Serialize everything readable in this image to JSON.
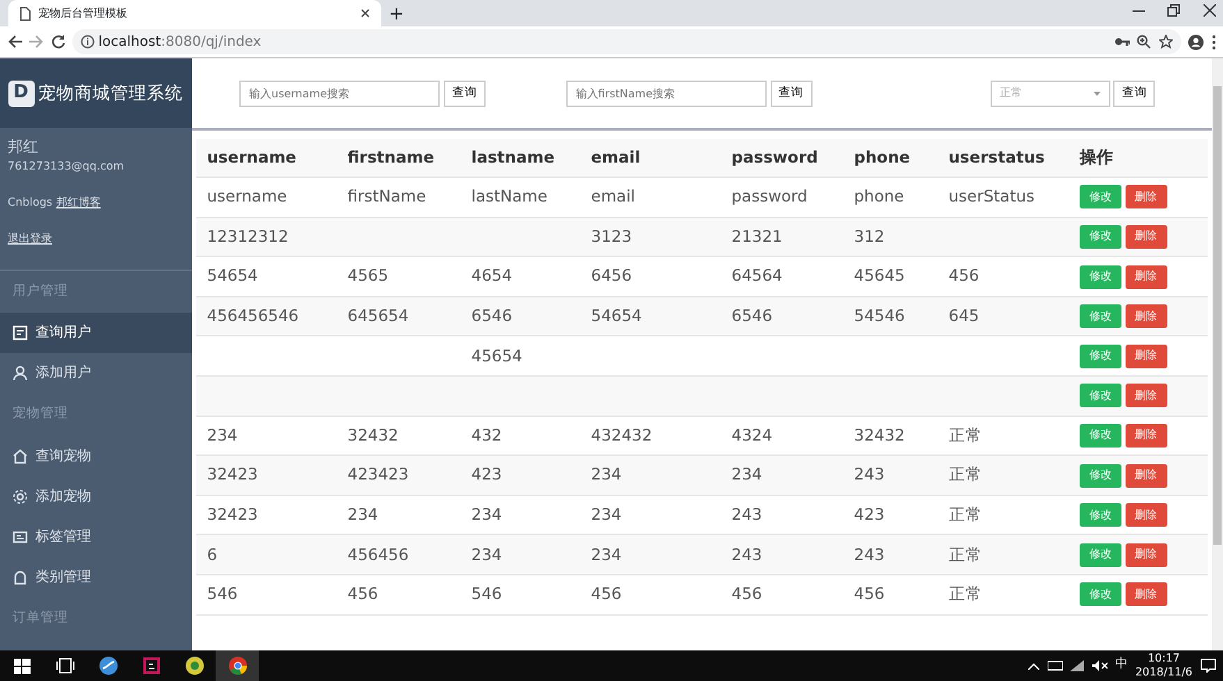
{
  "browser": {
    "tab_title": "宠物后台管理模板",
    "new_tab": "+",
    "url_host": "localhost",
    "url_rest": ":8080/qj/index"
  },
  "sidebar": {
    "brand": "宠物商城管理系统",
    "brand_letter": "D",
    "user_name": "邦红",
    "user_email": "761273133@qq.com",
    "blog_label": "Cnblogs",
    "blog_link": "邦红博客",
    "logout": "退出登录",
    "sections": [
      {
        "title": "用户管理",
        "items": [
          {
            "label": "查询用户",
            "selected": true
          },
          {
            "label": "添加用户",
            "selected": false
          }
        ]
      },
      {
        "title": "宠物管理",
        "items": [
          {
            "label": "查询宠物",
            "selected": false
          },
          {
            "label": "添加宠物",
            "selected": false
          },
          {
            "label": "标签管理",
            "selected": false
          },
          {
            "label": "类别管理",
            "selected": false
          }
        ]
      },
      {
        "title": "订单管理"
      }
    ]
  },
  "search": {
    "fields": [
      {
        "placeholder": "输入username搜索",
        "button": "查询"
      },
      {
        "placeholder": "输入firstName搜索",
        "button": "查询"
      }
    ],
    "select": {
      "value": "正常",
      "button": "查询"
    }
  },
  "table": {
    "columns": [
      "username",
      "firstname",
      "lastname",
      "email",
      "password",
      "phone",
      "userstatus",
      "操作"
    ],
    "rows": [
      {
        "cells": [
          "username",
          "firstName",
          "lastName",
          "email",
          "password",
          "phone",
          "userStatus"
        ],
        "actions": [
          "修改",
          "删除"
        ]
      },
      {
        "cells": [
          "12312312",
          "",
          "",
          "3123",
          "21321",
          "312",
          ""
        ],
        "actions": [
          "修改",
          "删除"
        ]
      },
      {
        "cells": [
          "54654",
          "4565",
          "4654",
          "6456",
          "64564",
          "45645",
          "456"
        ],
        "actions": [
          "修改",
          "删除"
        ]
      },
      {
        "cells": [
          "456456546",
          "645654",
          "6546",
          "54654",
          "6546",
          "54546",
          "645"
        ],
        "actions": [
          "修改",
          "删除"
        ]
      },
      {
        "cells": [
          "",
          "",
          "45654",
          "",
          "",
          "",
          ""
        ],
        "actions": [
          "修改",
          "删除"
        ]
      },
      {
        "cells": [
          "",
          "",
          "",
          "",
          "",
          "",
          ""
        ],
        "actions": [
          "修改",
          "删除"
        ]
      },
      {
        "cells": [
          "234",
          "32432",
          "432",
          "432432",
          "4324",
          "32432",
          "正常"
        ],
        "actions": [
          "修改",
          "删除"
        ]
      },
      {
        "cells": [
          "32423",
          "423423",
          "423",
          "234",
          "234",
          "243",
          "正常"
        ],
        "actions": [
          "修改",
          "删除"
        ]
      },
      {
        "cells": [
          "32423",
          "234",
          "234",
          "234",
          "243",
          "423",
          "正常"
        ],
        "actions": [
          "修改",
          "删除"
        ]
      },
      {
        "cells": [
          "6",
          "456456",
          "234",
          "234",
          "243",
          "243",
          "正常"
        ],
        "actions": [
          "修改",
          "删除"
        ]
      },
      {
        "cells": [
          "546",
          "456",
          "546",
          "456",
          "456",
          "456",
          "正常"
        ],
        "actions": [
          "修改",
          "删除"
        ]
      }
    ]
  },
  "taskbar": {
    "ime": "中",
    "time": "10:17",
    "date": "2018/11/6"
  }
}
